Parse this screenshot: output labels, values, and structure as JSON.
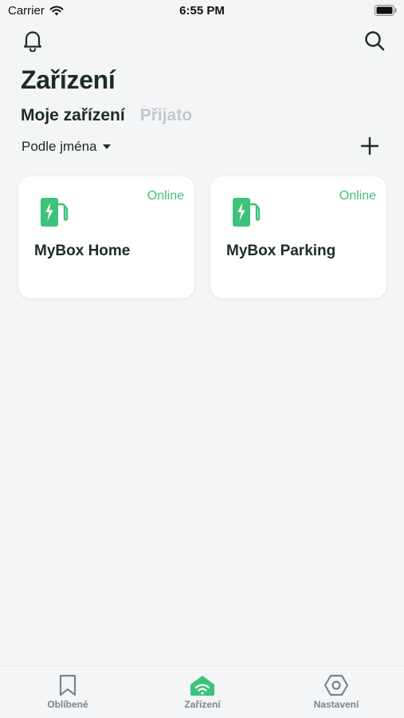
{
  "status_bar": {
    "carrier": "Carrier",
    "time": "6:55 PM"
  },
  "header": {
    "bell_icon": "bell-icon",
    "search_icon": "search-icon"
  },
  "page_title": "Zařízení",
  "tabs": [
    {
      "label": "Moje zařízení",
      "active": true
    },
    {
      "label": "Přijato",
      "active": false
    }
  ],
  "sort": {
    "label": "Podle jména"
  },
  "add_icon": "plus-icon",
  "devices": [
    {
      "name": "MyBox Home",
      "status": "Online",
      "icon": "ev-charger-icon"
    },
    {
      "name": "MyBox Parking",
      "status": "Online",
      "icon": "ev-charger-icon"
    }
  ],
  "bottom_nav": [
    {
      "label": "Oblíbené",
      "icon": "bookmark-icon",
      "active": false
    },
    {
      "label": "Zařízení",
      "icon": "devices-icon",
      "active": true
    },
    {
      "label": "Nastavení",
      "icon": "settings-hexagon-icon",
      "active": false
    }
  ],
  "colors": {
    "accent": "#3dc27a",
    "background": "#f4f5f7",
    "text": "#1c2b27",
    "inactive_tab": "#c3c7cb"
  }
}
